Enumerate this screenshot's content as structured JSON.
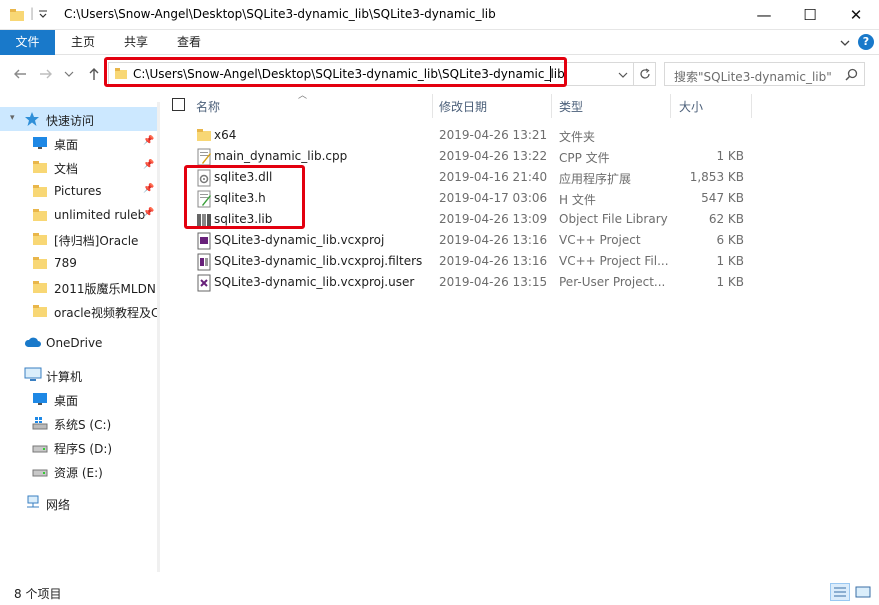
{
  "window": {
    "title": "C:\\Users\\Snow-Angel\\Desktop\\SQLite3-dynamic_lib\\SQLite3-dynamic_lib",
    "minimize": "—",
    "maximize": "☐",
    "close": "✕"
  },
  "ribbon": {
    "tabs": [
      "文件",
      "主页",
      "共享",
      "查看"
    ],
    "help": "?"
  },
  "address": {
    "path": "C:\\Users\\Snow-Angel\\Desktop\\SQLite3-dynamic_lib\\SQLite3-dynamic_lib",
    "search_placeholder": "搜索\"SQLite3-dynamic_lib\""
  },
  "sidebar": {
    "quick_access": "快速访问",
    "quick_items": [
      {
        "label": "桌面",
        "pinned": true,
        "icon": "desktop-icon"
      },
      {
        "label": "文档",
        "pinned": true,
        "icon": "folder-icon"
      },
      {
        "label": "Pictures",
        "pinned": true,
        "icon": "folder-icon"
      },
      {
        "label": "unlimited ruleb",
        "pinned": true,
        "icon": "folder-icon"
      },
      {
        "label": "[待归档]Oracle",
        "pinned": false,
        "icon": "folder-icon"
      },
      {
        "label": "789",
        "pinned": false,
        "icon": "folder-icon"
      },
      {
        "label": "2011版魔乐MLDN",
        "pinned": false,
        "icon": "folder-icon"
      },
      {
        "label": "oracle视频教程及C",
        "pinned": false,
        "icon": "folder-icon"
      }
    ],
    "onedrive": "OneDrive",
    "this_pc": "计算机",
    "pc_items": [
      {
        "label": "桌面",
        "icon": "desktop-icon"
      },
      {
        "label": "系统S (C:)",
        "icon": "windows-drive-icon"
      },
      {
        "label": "程序S (D:)",
        "icon": "drive-icon"
      },
      {
        "label": "资源 (E:)",
        "icon": "drive-icon"
      }
    ],
    "network": "网络"
  },
  "columns": {
    "name": "名称",
    "date": "修改日期",
    "type": "类型",
    "size": "大小"
  },
  "files": [
    {
      "name": "x64",
      "date": "2019-04-26 13:21",
      "type": "文件夹",
      "size": "",
      "icon": "folder-icon"
    },
    {
      "name": "main_dynamic_lib.cpp",
      "date": "2019-04-26 13:22",
      "type": "CPP 文件",
      "size": "1 KB",
      "icon": "cpp-file-icon"
    },
    {
      "name": "sqlite3.dll",
      "date": "2019-04-16 21:40",
      "type": "应用程序扩展",
      "size": "1,853 KB",
      "icon": "dll-file-icon"
    },
    {
      "name": "sqlite3.h",
      "date": "2019-04-17 03:06",
      "type": "H 文件",
      "size": "547 KB",
      "icon": "header-file-icon"
    },
    {
      "name": "sqlite3.lib",
      "date": "2019-04-26 13:09",
      "type": "Object File Library",
      "size": "62 KB",
      "icon": "lib-file-icon"
    },
    {
      "name": "SQLite3-dynamic_lib.vcxproj",
      "date": "2019-04-26 13:16",
      "type": "VC++ Project",
      "size": "6 KB",
      "icon": "vcxproj-file-icon"
    },
    {
      "name": "SQLite3-dynamic_lib.vcxproj.filters",
      "date": "2019-04-26 13:16",
      "type": "VC++ Project Fil...",
      "size": "1 KB",
      "icon": "filters-file-icon"
    },
    {
      "name": "SQLite3-dynamic_lib.vcxproj.user",
      "date": "2019-04-26 13:15",
      "type": "Per-User Project...",
      "size": "1 KB",
      "icon": "user-file-icon"
    }
  ],
  "status": {
    "count": "8 个项目"
  },
  "colors": {
    "accent": "#1979ca",
    "highlight": "#e3000f",
    "folder": "#f8d775"
  }
}
